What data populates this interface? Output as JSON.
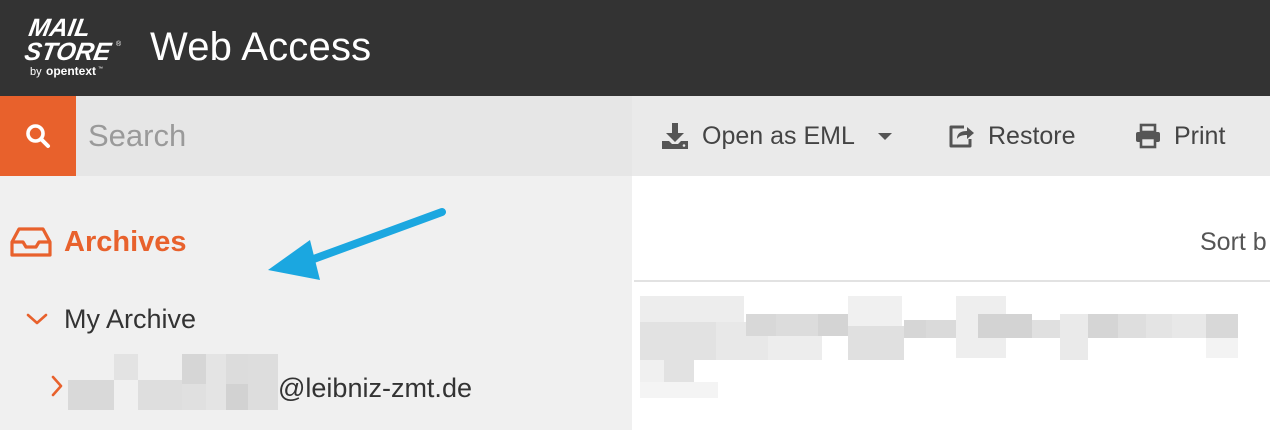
{
  "header": {
    "logo_text": "MAIL STORE by opentext",
    "app_title": "Web Access"
  },
  "search": {
    "icon": "search-icon",
    "placeholder": "Search"
  },
  "sidebar": {
    "archives_icon": "inbox-tray-icon",
    "archives_title": "Archives",
    "my_archive": {
      "icon": "chevron-down-icon",
      "label": "My Archive"
    },
    "mailbox": {
      "icon": "chevron-right-icon",
      "domain_label": "@leibniz-zmt.de"
    }
  },
  "toolbar": {
    "open_eml": {
      "icon": "download-icon",
      "label": "Open as EML",
      "dropdown_icon": "caret-down-icon"
    },
    "restore": {
      "icon": "share-icon",
      "label": "Restore"
    },
    "print": {
      "icon": "printer-icon",
      "label": "Print"
    }
  },
  "list": {
    "sort_label": "Sort b"
  },
  "colors": {
    "header_bg": "#333333",
    "accent": "#e8612c",
    "annotation": "#1ba7e0",
    "sidebar_bg": "#f0f0f0",
    "toolbar_bg": "#eaeaea"
  }
}
